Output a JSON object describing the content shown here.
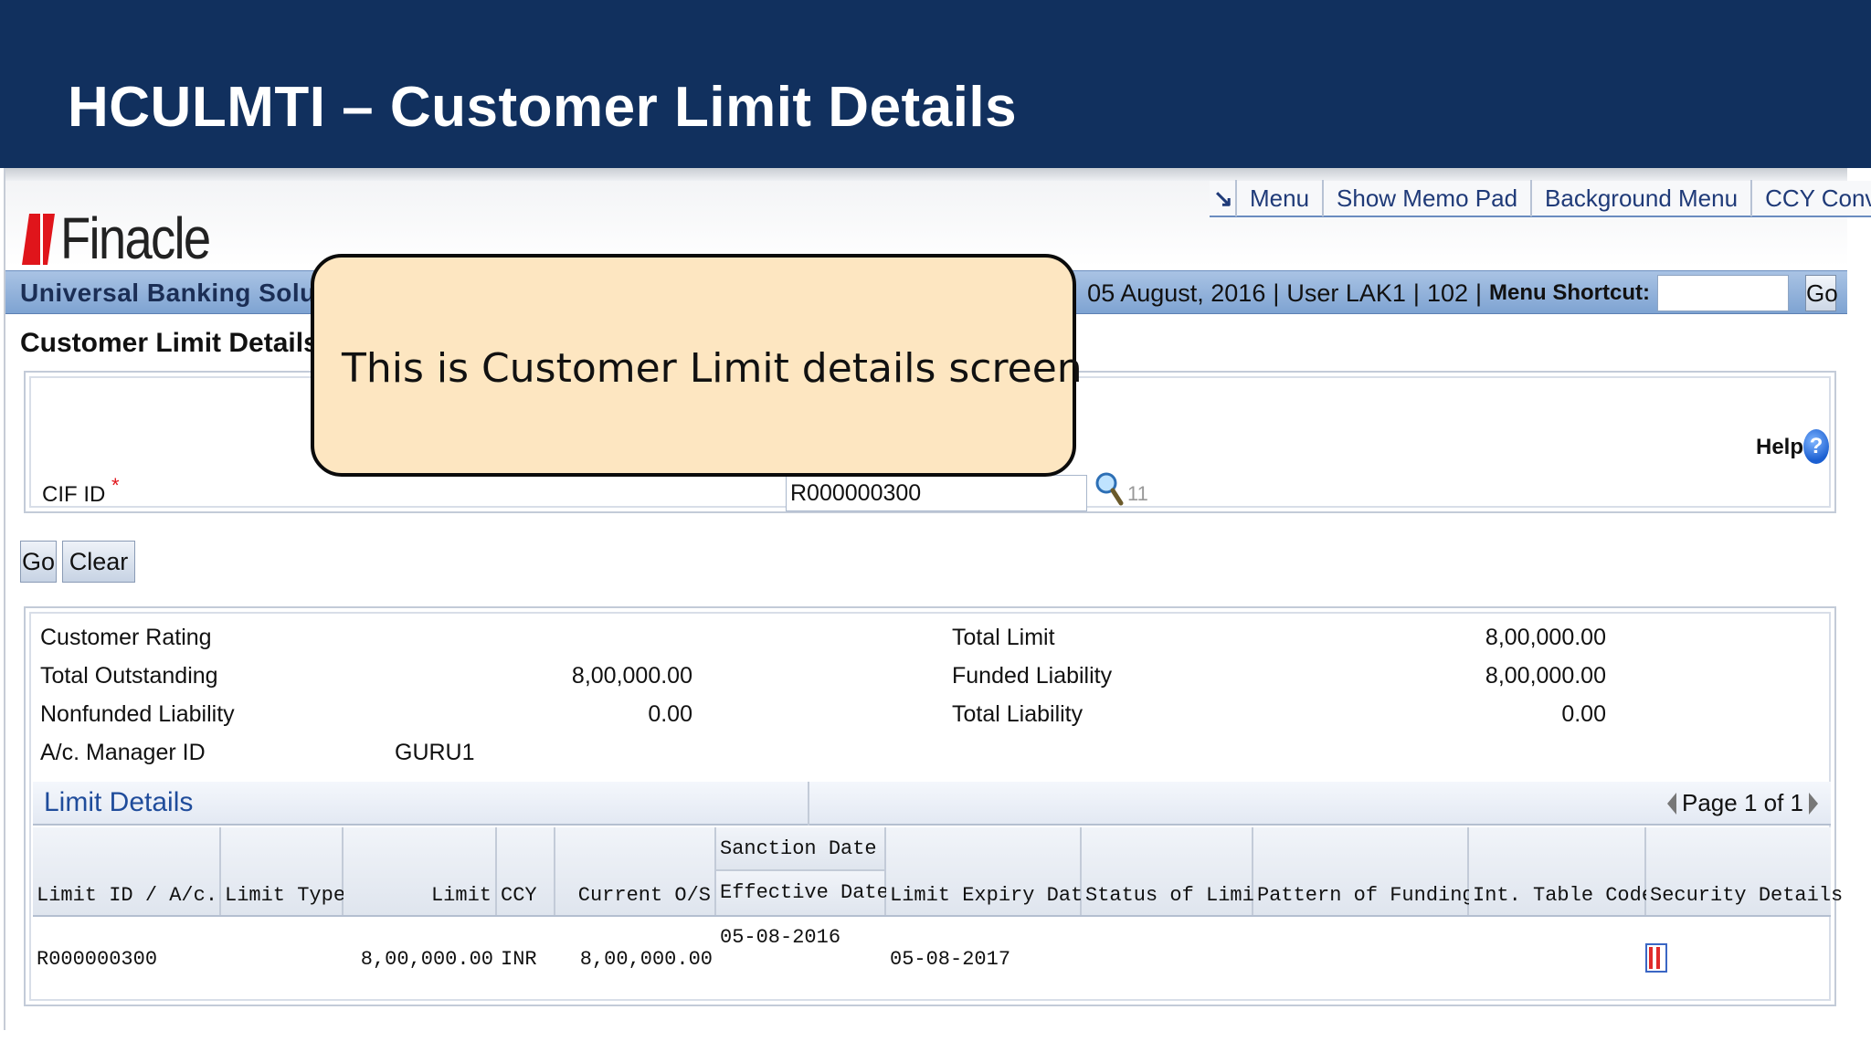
{
  "slide": {
    "title": "HCULMTI – Customer Limit Details"
  },
  "app": {
    "logo_text": "Finacle",
    "nav": [
      "Menu",
      "Show Memo Pad",
      "Background Menu",
      "CCY Converter"
    ],
    "band_left": "Universal Banking Solution from",
    "band_date": "05 August, 2016",
    "band_user": "User LAK1",
    "band_sol": "102",
    "menu_shortcut_label": "Menu Shortcut:",
    "menu_shortcut_value": "",
    "go_label": "Go"
  },
  "page": {
    "heading": "Customer Limit Details",
    "help_label": "Help",
    "help_icon": "?",
    "cif_label": "CIF ID",
    "cif_required": "*",
    "cif_value": "R000000300",
    "cif_count": "11",
    "go_button": "Go",
    "clear_button": "Clear"
  },
  "summary": {
    "customer_rating_label": "Customer Rating",
    "customer_rating_value": "",
    "total_outstanding_label": "Total Outstanding",
    "total_outstanding_value": "8,00,000.00",
    "nonfunded_liability_label": "Nonfunded Liability",
    "nonfunded_liability_value": "0.00",
    "manager_label": "A/c. Manager ID",
    "manager_value": "GURU1",
    "total_limit_label": "Total Limit",
    "total_limit_value": "8,00,000.00",
    "funded_liability_label": "Funded Liability",
    "funded_liability_value": "8,00,000.00",
    "total_liability_label": "Total Liability",
    "total_liability_value": "0.00"
  },
  "limit_details": {
    "title": "Limit Details",
    "pager": "Page 1 of 1",
    "columns": {
      "limit_id": "Limit ID / A/c. ID",
      "limit_type": "Limit Type",
      "limit": "Limit",
      "ccy": "CCY",
      "current_os": "Current O/S",
      "sanction_date": "Sanction Date",
      "effective_date": "Effective Date",
      "expiry_date": "Limit Expiry Date",
      "status": "Status of Limit",
      "pattern": "Pattern of Funding",
      "int_table": "Int. Table Code",
      "security": "Security Details"
    },
    "rows": [
      {
        "limit_id": "R000000300",
        "limit_type": "",
        "limit": "8,00,000.00",
        "ccy": "INR",
        "current_os": "8,00,000.00",
        "sanction_date": "05-08-2016",
        "effective_date": "",
        "expiry_date": "05-08-2017",
        "status": "",
        "pattern": "",
        "int_table": "",
        "security_icon": "security-details-icon"
      }
    ]
  },
  "callout": {
    "text": "This is Customer Limit details screen"
  },
  "colors": {
    "header_bg": "#11305e",
    "callout_bg": "#fde6c1",
    "band_blue": "#7ea3d2",
    "link_blue": "#1f4c9b",
    "logo_red": "#e0151b"
  }
}
